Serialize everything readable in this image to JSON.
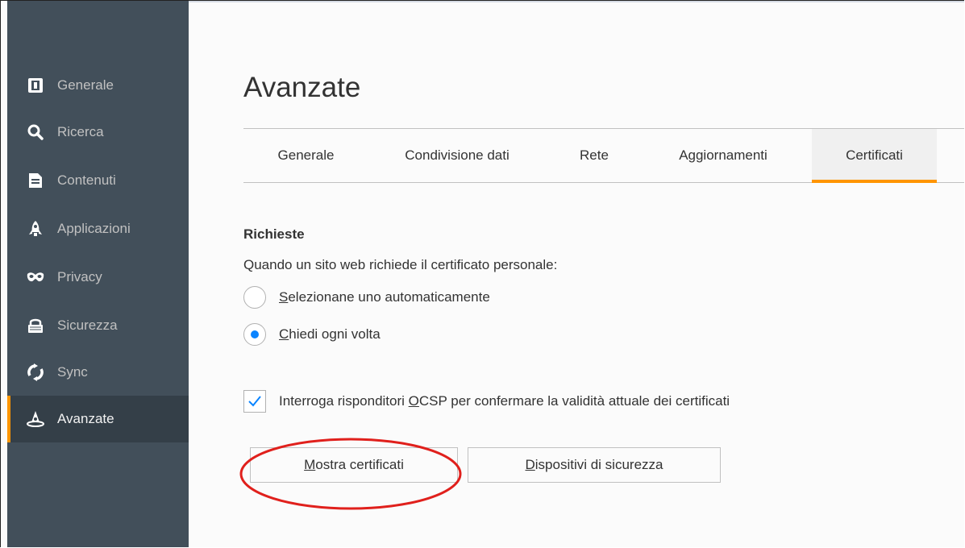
{
  "sidebar": {
    "items": [
      {
        "label": "Generale",
        "icon": "general-icon"
      },
      {
        "label": "Ricerca",
        "icon": "search-icon"
      },
      {
        "label": "Contenuti",
        "icon": "document-icon"
      },
      {
        "label": "Applicazioni",
        "icon": "rocket-icon"
      },
      {
        "label": "Privacy",
        "icon": "mask-icon"
      },
      {
        "label": "Sicurezza",
        "icon": "lock-icon"
      },
      {
        "label": "Sync",
        "icon": "sync-icon"
      },
      {
        "label": "Avanzate",
        "icon": "wizard-hat-icon",
        "active": true
      }
    ]
  },
  "main": {
    "title": "Avanzate",
    "tabs": [
      {
        "label": "Generale"
      },
      {
        "label": "Condivisione dati"
      },
      {
        "label": "Rete"
      },
      {
        "label": "Aggiornamenti"
      },
      {
        "label": "Certificati",
        "selected": true
      }
    ],
    "section_title": "Richieste",
    "description": "Quando un sito web richiede il certificato personale:",
    "radio_auto": {
      "accesskey": "S",
      "rest": "elezionane uno automaticamente",
      "checked": false
    },
    "radio_ask": {
      "accesskey": "C",
      "rest": "hiedi ogni volta",
      "checked": true
    },
    "ocsp": {
      "before": "Interroga risponditori ",
      "accesskey": "O",
      "after": "CSP per confermare la validità attuale dei certificati",
      "checked": true
    },
    "btn_show": {
      "accesskey": "M",
      "rest": "ostra certificati"
    },
    "btn_devices": {
      "accesskey": "D",
      "rest": "ispositivi di sicurezza"
    }
  },
  "colors": {
    "accent": "#ff9500",
    "sidebar": "#424f5a",
    "checked": "#0a84ff",
    "annotation": "#e0201c"
  }
}
